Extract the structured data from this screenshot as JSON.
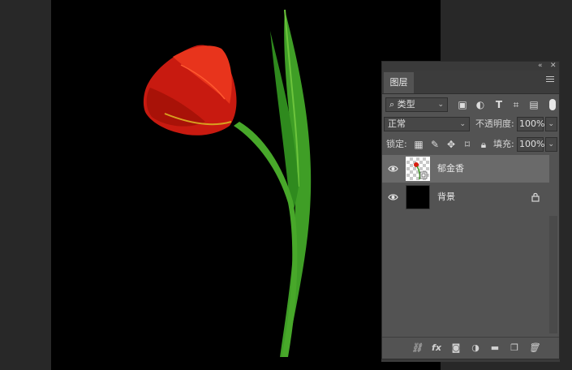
{
  "panel": {
    "tab_label": "图层",
    "collapse_icon": "double-chevron-icon",
    "close_icon": "close-icon",
    "menu_icon": "hamburger-menu-icon"
  },
  "filter": {
    "kind_label": "类型",
    "icons": [
      "pixel-filter-icon",
      "adjustment-filter-icon",
      "type-filter-icon",
      "shape-filter-icon",
      "smartobject-filter-icon"
    ]
  },
  "blend": {
    "mode": "正常",
    "opacity_label": "不透明度:",
    "opacity_value": "100%"
  },
  "lock": {
    "label": "锁定:",
    "fill_label": "填充:",
    "fill_value": "100%"
  },
  "layers": [
    {
      "name": "郁金香",
      "selected": true,
      "visible": true
    },
    {
      "name": "背景",
      "selected": false,
      "visible": true,
      "locked": true
    }
  ],
  "colors": {
    "panel_bg": "#535353",
    "selected_layer": "#6a6a6a",
    "canvas_bg": "#000000",
    "workspace": "#282828",
    "tulip_red": "#d81f10",
    "stem_green": "#3c9a22"
  }
}
